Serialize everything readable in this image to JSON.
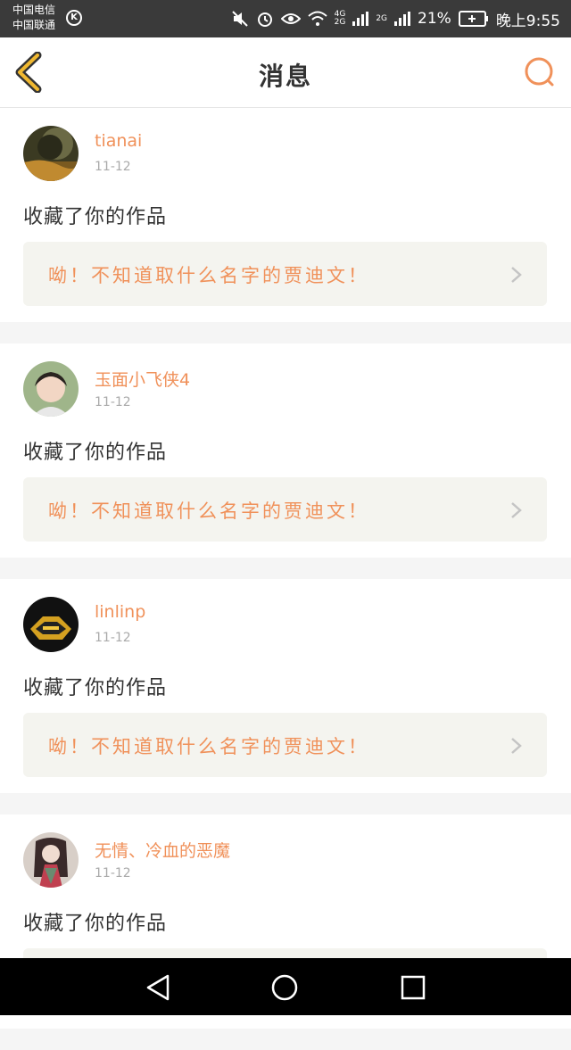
{
  "status_bar": {
    "carrier_1": "中国电信",
    "carrier_2": "中国联通",
    "carrier_badge": "K",
    "network_top": "4G",
    "network_bottom": "2G",
    "network_2": "2G",
    "battery": "21%",
    "time": "晚上9:55"
  },
  "header": {
    "title": "消息",
    "accent_color": "#f0b830",
    "search_color": "#f0915a"
  },
  "messages": [
    {
      "username": "tianai",
      "date": "11-12",
      "action": "收藏了你的作品",
      "work_title": "呦！不知道取什么名字的贾迪文！"
    },
    {
      "username": "玉面小飞侠4",
      "date": "11-12",
      "action": "收藏了你的作品",
      "work_title": "呦！不知道取什么名字的贾迪文！"
    },
    {
      "username": "linlinp",
      "date": "11-12",
      "action": "收藏了你的作品",
      "work_title": "呦！不知道取什么名字的贾迪文！"
    },
    {
      "username": "无情、冷血的恶魔",
      "date": "11-12",
      "action": "收藏了你的作品",
      "work_title": ""
    }
  ],
  "colors": {
    "username": "#f0915a",
    "work_title": "#f0915a",
    "work_bg": "#f4f4ef"
  }
}
